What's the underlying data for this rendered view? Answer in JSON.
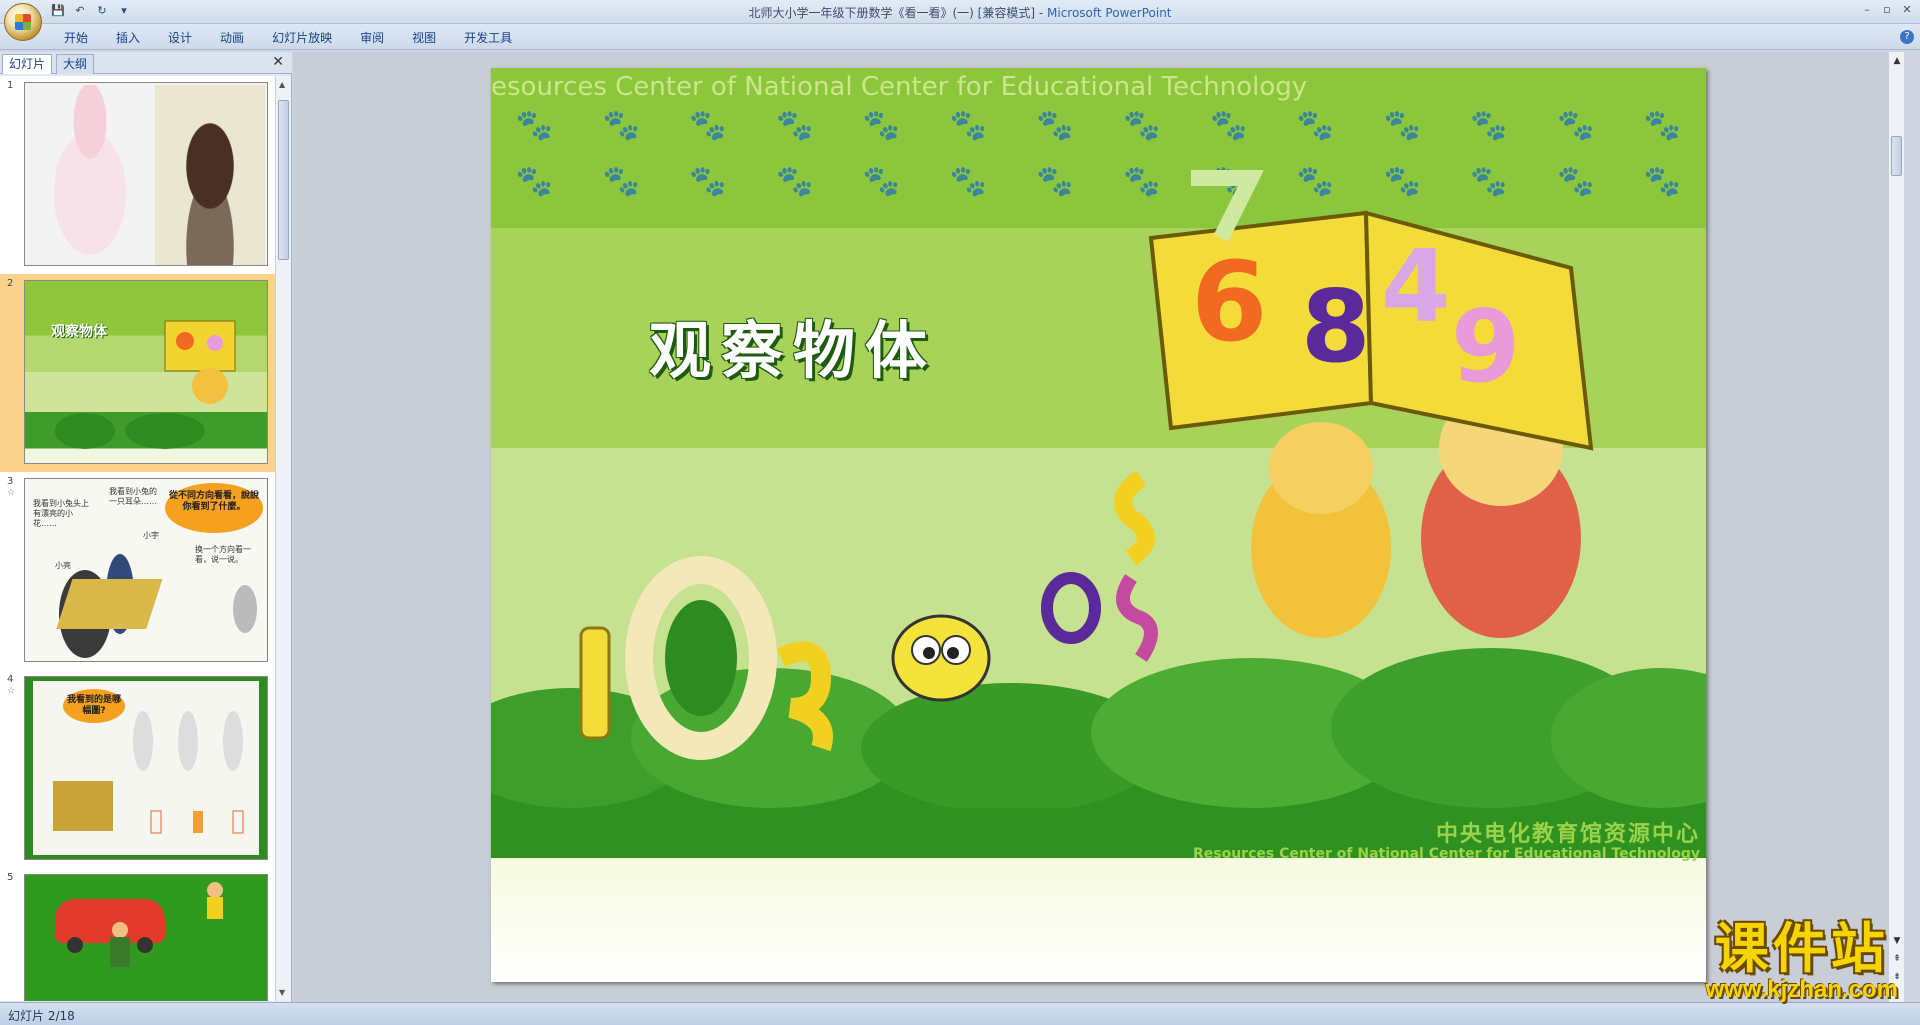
{
  "window": {
    "title": "北师大小学一年级下册数学《看一看》(一) [兼容模式] - ",
    "app_name": "Microsoft PowerPoint",
    "controls": [
      "–",
      "▫",
      "✕"
    ]
  },
  "qat": {
    "save_icon": "💾",
    "undo_icon": "↶",
    "redo_icon": "↻",
    "more_icon": "▾"
  },
  "ribbon": {
    "tabs": [
      "开始",
      "插入",
      "设计",
      "动画",
      "幻灯片放映",
      "审阅",
      "视图",
      "开发工具"
    ],
    "help_icon": "?"
  },
  "left_pane": {
    "tabs": [
      "幻灯片",
      "大纲"
    ],
    "close_icon": "✕",
    "slides": [
      {
        "number": "1",
        "has_anim": false
      },
      {
        "number": "2",
        "has_anim": false,
        "title": "观察物体"
      },
      {
        "number": "3",
        "has_anim": true,
        "bubble": "從不同方向看看，說說你看到了什麼。",
        "notes": [
          "我看到小兔头上有漂亮的小花……",
          "我看到小兔的一只耳朵……",
          "小宇",
          "小亮",
          "换一个方向看一看，说一说。"
        ]
      },
      {
        "number": "4",
        "has_anim": true,
        "bubble": "我看到的是哪幅圖?"
      },
      {
        "number": "5",
        "has_anim": false
      }
    ],
    "anim_icon": "☆"
  },
  "slide": {
    "title": "观察物体",
    "watermark_top": "esources Center of National  Center for Educational Technology",
    "logo_cn": "中央电化教育馆资源中心",
    "logo_en": "Resources Center of National Center for Educational Technology",
    "book_digits": [
      "6",
      "8",
      "4",
      "9"
    ],
    "top_digit": "7",
    "ground_digits": [
      "1",
      "0",
      "3",
      "2",
      "0",
      "5"
    ]
  },
  "status": {
    "text": "幻灯片 2/18"
  },
  "corner_watermark": {
    "cn": "课件站",
    "url": "www.kjzhan.com"
  },
  "colors": {
    "slide_green": "#8cc63c",
    "dark_green": "#2f9220",
    "selected_thumb": "#fbd28c",
    "watermark_yellow": "#f6d400"
  }
}
